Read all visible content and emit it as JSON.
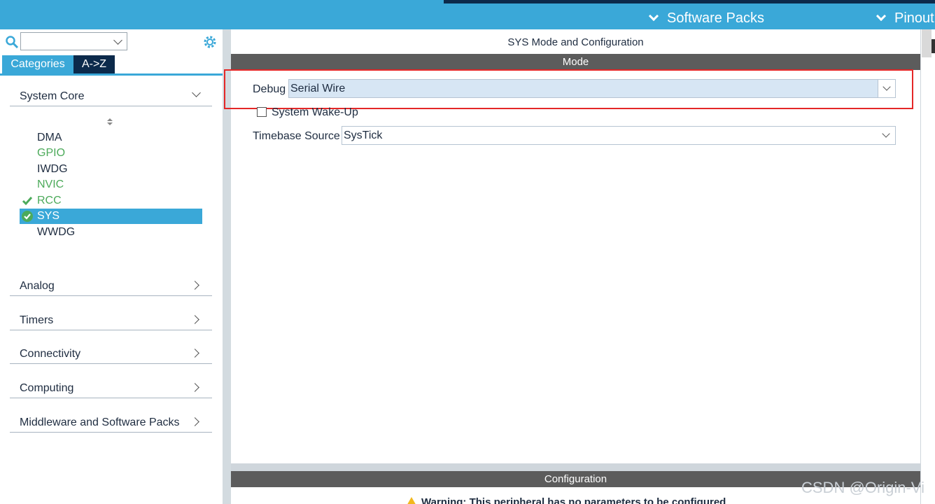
{
  "topbar": {
    "software_packs": "Software Packs",
    "pinout": "Pinout"
  },
  "left": {
    "tabs": [
      "Categories",
      "A->Z"
    ],
    "sections": {
      "system_core": "System Core",
      "analog": "Analog",
      "timers": "Timers",
      "connectivity": "Connectivity",
      "computing": "Computing",
      "middleware": "Middleware and Software Packs"
    },
    "items": [
      "DMA",
      "GPIO",
      "IWDG",
      "NVIC",
      "RCC",
      "SYS",
      "WWDG"
    ],
    "colors": {
      "accent": "#3aa8d8",
      "dark": "#0c2a4b",
      "green": "#4caa5a"
    }
  },
  "main": {
    "title": "SYS Mode and Configuration",
    "mode_header": "Mode",
    "debug_label": "Debug",
    "debug_value": "Serial Wire",
    "wake_up_label": "System Wake-Up",
    "timebase_label": "Timebase Source",
    "timebase_value": "SysTick",
    "config_header": "Configuration",
    "warning": "Warning: This peripheral has no parameters to be configured"
  },
  "watermark": "CSDN @Origin-Vi"
}
